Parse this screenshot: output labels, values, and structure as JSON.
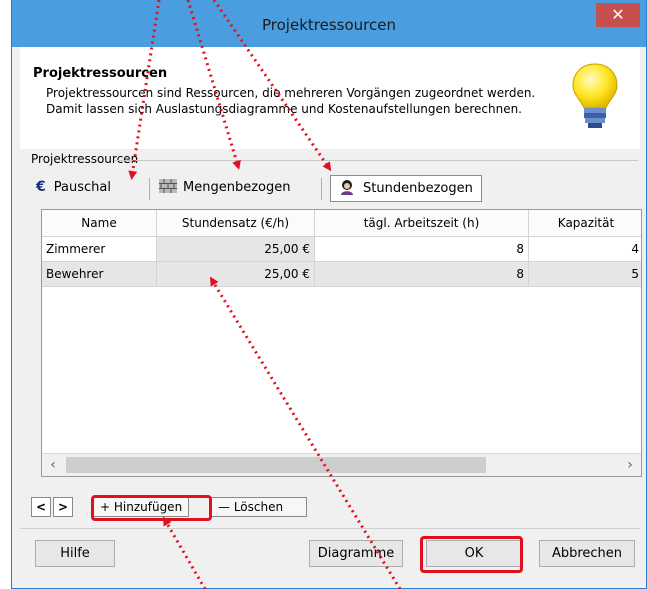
{
  "window": {
    "title": "Projektressourcen",
    "close_label": "✕"
  },
  "header": {
    "title": "Projektressourcen",
    "description": "Projektressourcen sind Ressourcen, die mehreren Vorgängen zugeordnet werden. Damit lassen sich Auslastungsdiagramme und Kostenaufstellungen berechnen."
  },
  "group_label": "Projektressourcen",
  "tabs": [
    {
      "label": "Pauschal",
      "icon": "euro-icon"
    },
    {
      "label": "Mengenbezogen",
      "icon": "brick-wall-icon"
    },
    {
      "label": "Stundenbezogen",
      "icon": "worker-icon",
      "active": true
    }
  ],
  "table": {
    "columns": [
      "Name",
      "Stundensatz (€/h)",
      "tägl. Arbeitszeit (h)",
      "Kapazität"
    ],
    "rows": [
      {
        "name": "Zimmerer",
        "rate": "25,00 €",
        "hours": "8",
        "capacity": "4"
      },
      {
        "name": "Bewehrer",
        "rate": "25,00 €",
        "hours": "8",
        "capacity": "5"
      }
    ]
  },
  "toolbar": {
    "prev": "<",
    "next": ">",
    "add_label": "+ Hinzufügen",
    "delete_label": "— Löschen"
  },
  "buttons": {
    "help": "Hilfe",
    "diagrams": "Diagramme",
    "ok": "OK",
    "cancel": "Abbrechen"
  },
  "colors": {
    "title_bar": "#4a9ee0",
    "close": "#c7504f",
    "highlight": "#e0101e"
  }
}
